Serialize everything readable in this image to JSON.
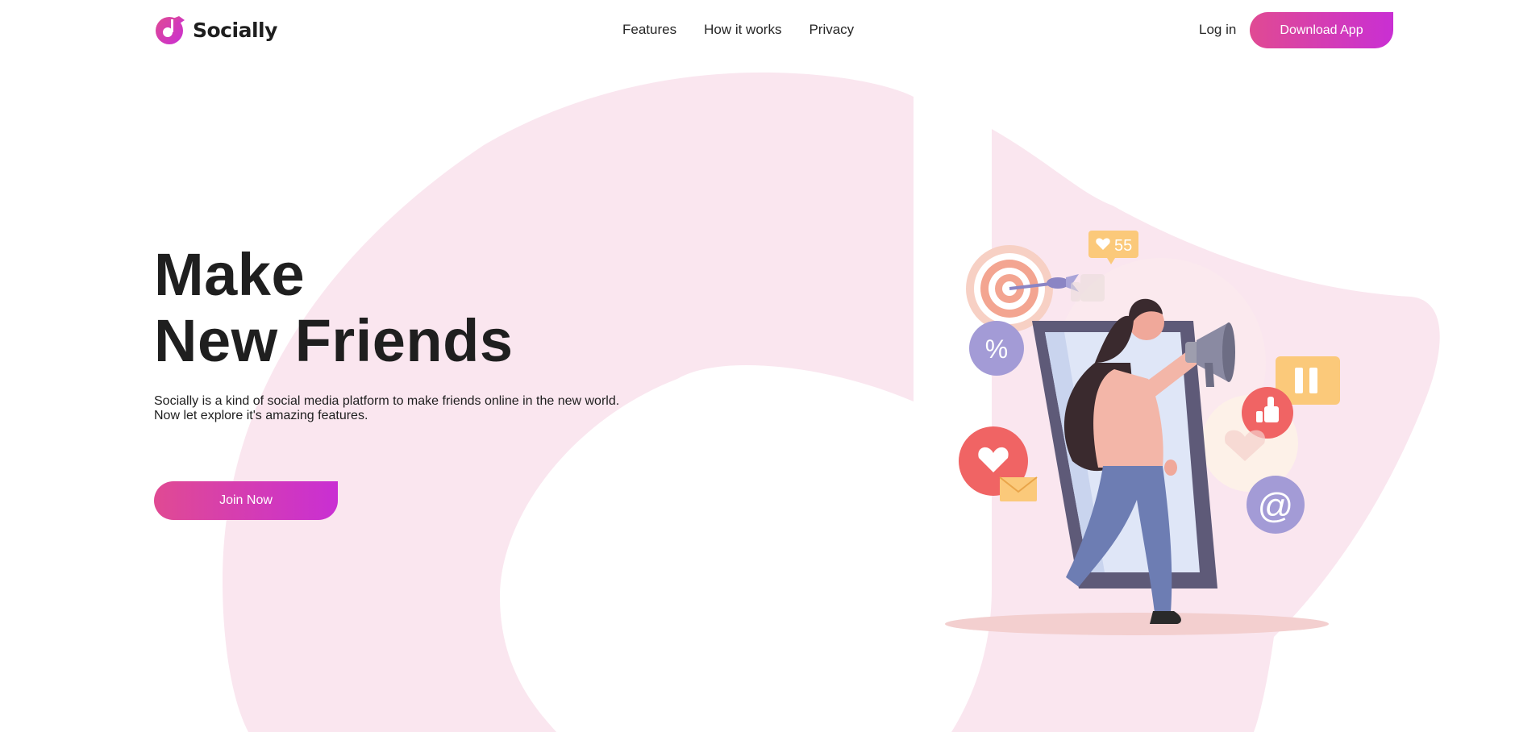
{
  "brand": {
    "name": "Socially",
    "accent": "#d23bb6",
    "gradient_start": "#e04a93",
    "gradient_end": "#c92fd3",
    "background_tint": "#fae6ef"
  },
  "nav": {
    "links": [
      {
        "label": "Features"
      },
      {
        "label": "How it works"
      },
      {
        "label": "Privacy"
      }
    ],
    "login_label": "Log in",
    "download_label": "Download App"
  },
  "hero": {
    "title_line1": "Make",
    "title_line2": "New Friends",
    "description_line1": "Socially is a kind of social media platform to make friends online in the new world.",
    "description_line2": "Now let explore it's amazing features.",
    "cta_label": "Join Now"
  },
  "illustration": {
    "like_count": "55",
    "percent_symbol": "%",
    "at_symbol": "@",
    "icons": [
      "target-icon",
      "dart-icon",
      "like-bubble-icon",
      "percent-icon",
      "heart-icon",
      "envelope-icon",
      "thumbs-up-icon",
      "pause-icon",
      "at-icon",
      "megaphone-icon",
      "phone-icon",
      "woman-figure"
    ]
  }
}
